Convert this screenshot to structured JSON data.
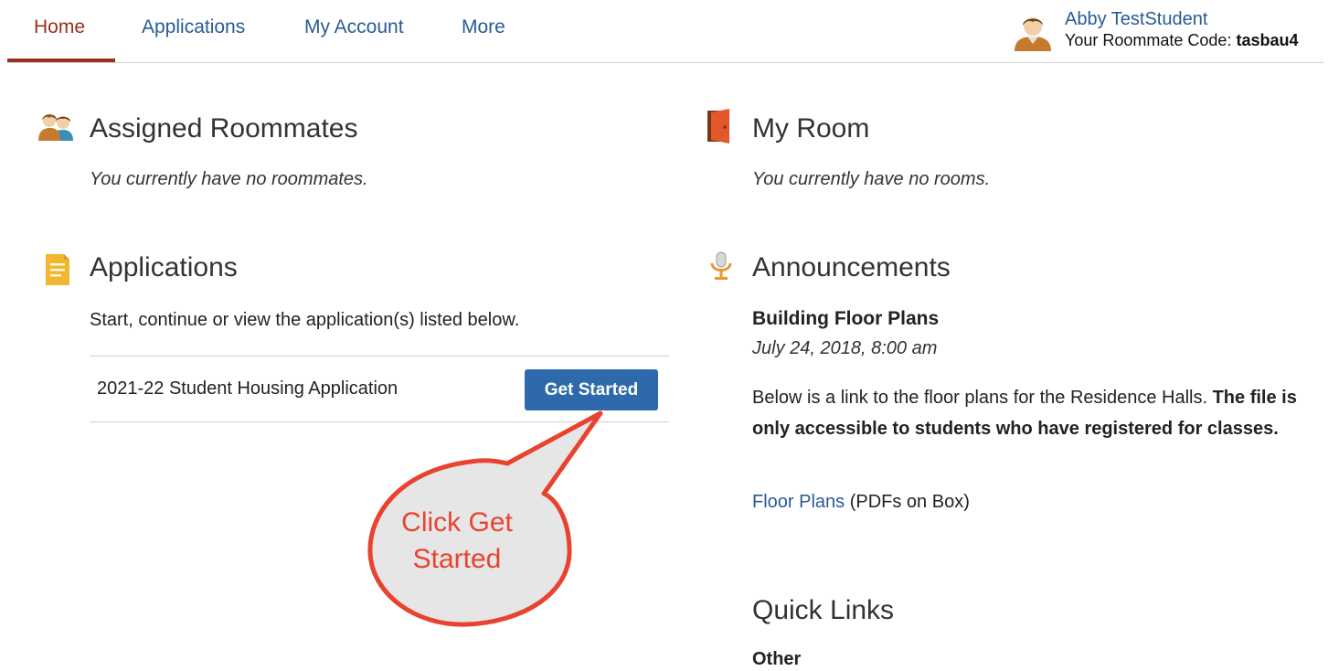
{
  "nav": {
    "tabs": [
      {
        "label": "Home",
        "active": true
      },
      {
        "label": "Applications",
        "active": false
      },
      {
        "label": "My Account",
        "active": false
      },
      {
        "label": "More",
        "active": false
      }
    ],
    "user": {
      "name": "Abby TestStudent",
      "code_label": "Your Roommate Code:",
      "code_value": "tasbau4"
    }
  },
  "roommates": {
    "title": "Assigned Roommates",
    "empty_text": "You currently have no roommates."
  },
  "my_room": {
    "title": "My Room",
    "empty_text": "You currently have no rooms."
  },
  "applications": {
    "title": "Applications",
    "intro": "Start, continue or view the application(s) listed below.",
    "items": [
      {
        "name": "2021-22 Student Housing Application",
        "button_label": "Get Started"
      }
    ]
  },
  "announcements": {
    "title": "Announcements",
    "item": {
      "heading": "Building Floor Plans",
      "date": "July 24, 2018, 8:00 am",
      "body_plain": "Below is a link to the floor plans for the Residence Halls. ",
      "body_bold": "The file is only accessible to students who have registered for classes.",
      "link_text": "Floor Plans",
      "link_suffix": " (PDFs on Box)"
    }
  },
  "quick_links": {
    "title": "Quick Links",
    "group_label": "Other"
  },
  "callout": {
    "line1": "Click Get",
    "line2": "Started"
  },
  "colors": {
    "link_blue": "#2a5a95",
    "active_tab": "#9a2f1e",
    "button_blue": "#2e6aab",
    "callout_red": "#e8432e"
  },
  "icons": [
    "user-avatar-icon",
    "roommates-icon",
    "door-icon",
    "document-icon",
    "microphone-icon"
  ]
}
